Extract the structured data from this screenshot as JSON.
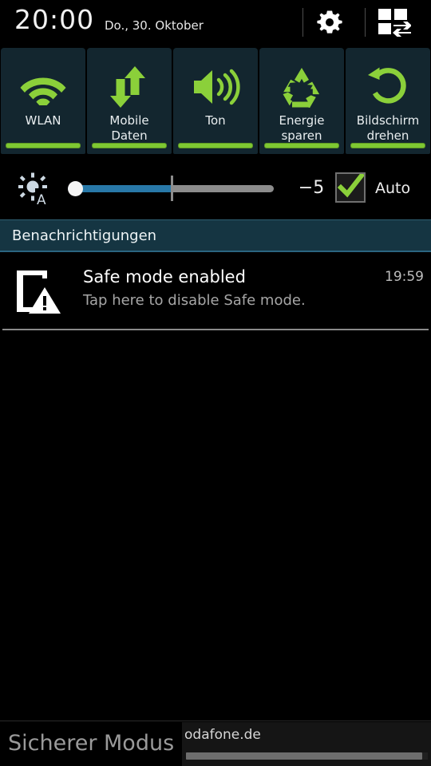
{
  "statusbar": {
    "time": "20:00",
    "date": "Do., 30. Oktober",
    "gear_icon": "gear-icon",
    "quick_settings_edit_icon": "grid-swap-icon"
  },
  "quick_tiles": [
    {
      "label": "WLAN",
      "icon": "wifi-icon",
      "enabled": true
    },
    {
      "label": "Mobile\nDaten",
      "icon": "data-sync-icon",
      "enabled": true
    },
    {
      "label": "Ton",
      "icon": "speaker-icon",
      "enabled": true
    },
    {
      "label": "Energie\nsparen",
      "icon": "recycle-icon",
      "enabled": true
    },
    {
      "label": "Bildschirm\ndrehen",
      "icon": "rotate-icon",
      "enabled": true
    }
  ],
  "brightness": {
    "icon": "brightness-auto-icon",
    "value": "−5",
    "auto_label": "Auto",
    "auto_checked": true,
    "slider_percent": 51,
    "tick_percent": 50
  },
  "notifications_header": {
    "title": "Benachrichtigungen"
  },
  "notification": {
    "icon": "tablet-warning-icon",
    "title": "Safe mode enabled",
    "subtitle": "Tap here to disable Safe mode.",
    "time": "19:59"
  },
  "bottom": {
    "safe_mode_badge": "Sicherer Modus",
    "web_url": "odafone.de"
  },
  "colors": {
    "accent_green": "#7ec832",
    "tile_bg": "#13262f",
    "notif_header_bg": "#153542",
    "slider_fill": "#2878a8",
    "background": "#000000"
  }
}
